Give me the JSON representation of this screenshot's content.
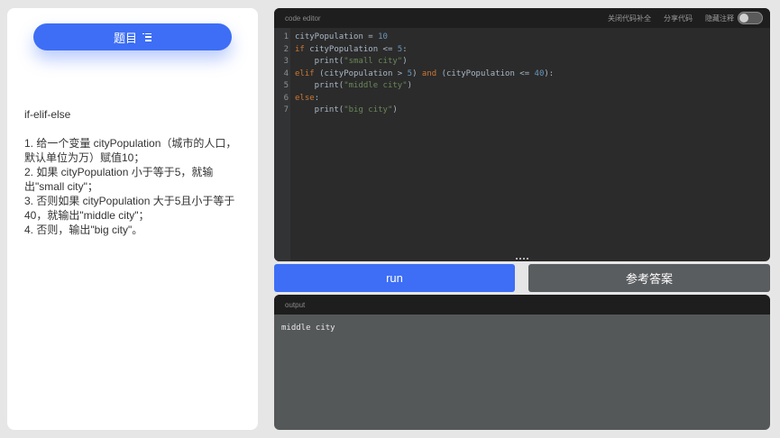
{
  "left_panel": {
    "title_button_label": "题目",
    "problem_heading": "if-elif-else",
    "problem_lines": [
      "1. 给一个变量 cityPopulation（城市的人口，默认单位为万）赋值10；",
      "2. 如果 cityPopulation 小于等于5，就输出\"small city\"；",
      "3. 否则如果 cityPopulation 大于5且小于等于40，就输出\"middle city\"；",
      "4. 否则，输出\"big city\"。"
    ]
  },
  "editor": {
    "title": "code editor",
    "actions": {
      "close_autocomplete": "关闭代码补全",
      "share_code": "分享代码",
      "hide_comments": "隐藏注释"
    },
    "hide_comments_toggle_on": false,
    "line_numbers": [
      "1",
      "2",
      "3",
      "4",
      "5",
      "6",
      "7"
    ],
    "code_lines": [
      "cityPopulation = 10",
      "if cityPopulation <= 5:",
      "    print(\"small city\")",
      "elif (cityPopulation > 5) and (cityPopulation <= 40):",
      "    print(\"middle city\")",
      "else:",
      "    print(\"big city\")"
    ]
  },
  "buttons": {
    "run": "run",
    "reference_answer": "参考答案"
  },
  "output": {
    "title": "output",
    "text": "middle city"
  },
  "colors": {
    "accent": "#3d6ef5",
    "editor_bg": "#2b2b2b",
    "keyword": "#cc7832",
    "number": "#6897bb",
    "string": "#6a8759"
  },
  "icons": {
    "title_button": "list-icon"
  }
}
